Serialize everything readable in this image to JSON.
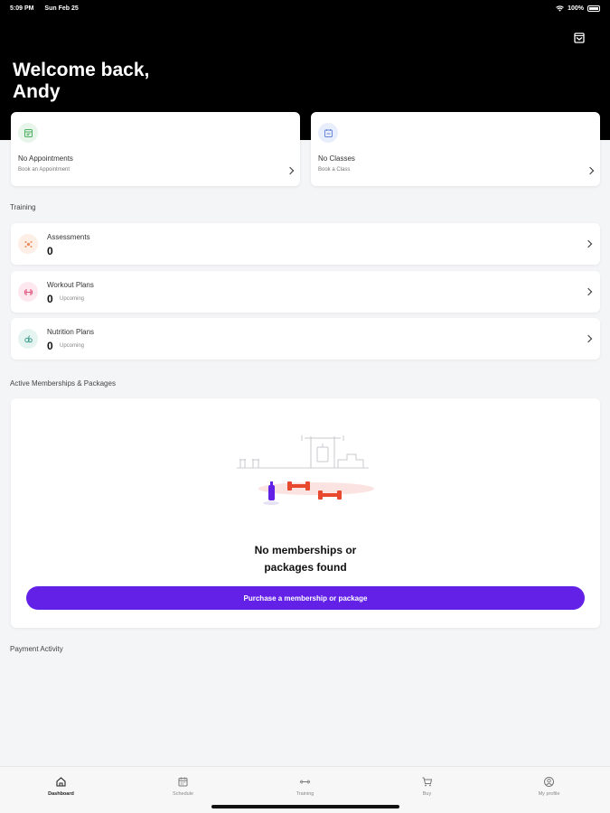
{
  "status_bar": {
    "time": "5:09 PM",
    "date": "Sun Feb 25",
    "battery": "100%"
  },
  "header": {
    "welcome_line1": "Welcome back,",
    "welcome_line2": "Andy"
  },
  "cards": {
    "appointments": {
      "title": "No Appointments",
      "subtitle": "Book an Appointment",
      "icon": "calendar-icon",
      "color": "#e7f5ea"
    },
    "classes": {
      "title": "No Classes",
      "subtitle": "Book a Class",
      "icon": "class-icon",
      "color": "#e8eefb"
    }
  },
  "training": {
    "label": "Training",
    "rows": [
      {
        "title": "Assessments",
        "count": "0",
        "upcoming": "",
        "icon": "assessment-icon",
        "color": "#fdeee6"
      },
      {
        "title": "Workout Plans",
        "count": "0",
        "upcoming": "Upcoming",
        "icon": "dumbbell-icon",
        "color": "#fde8ef"
      },
      {
        "title": "Nutrition Plans",
        "count": "0",
        "upcoming": "Upcoming",
        "icon": "nutrition-icon",
        "color": "#e6f4f1"
      }
    ]
  },
  "memberships": {
    "label": "Active Memberships & Packages",
    "empty_line1": "No memberships or",
    "empty_line2": "packages found",
    "button": "Purchase a membership or package",
    "accent": "#6321e8"
  },
  "payment": {
    "label": "Payment Activity"
  },
  "nav": [
    {
      "label": "Dashboard",
      "icon": "home-icon",
      "active": true
    },
    {
      "label": "Schedule",
      "icon": "calendar-icon",
      "active": false
    },
    {
      "label": "Training",
      "icon": "dumbbell-icon",
      "active": false
    },
    {
      "label": "Buy",
      "icon": "cart-icon",
      "active": false
    },
    {
      "label": "My profile",
      "icon": "profile-icon",
      "active": false
    }
  ]
}
